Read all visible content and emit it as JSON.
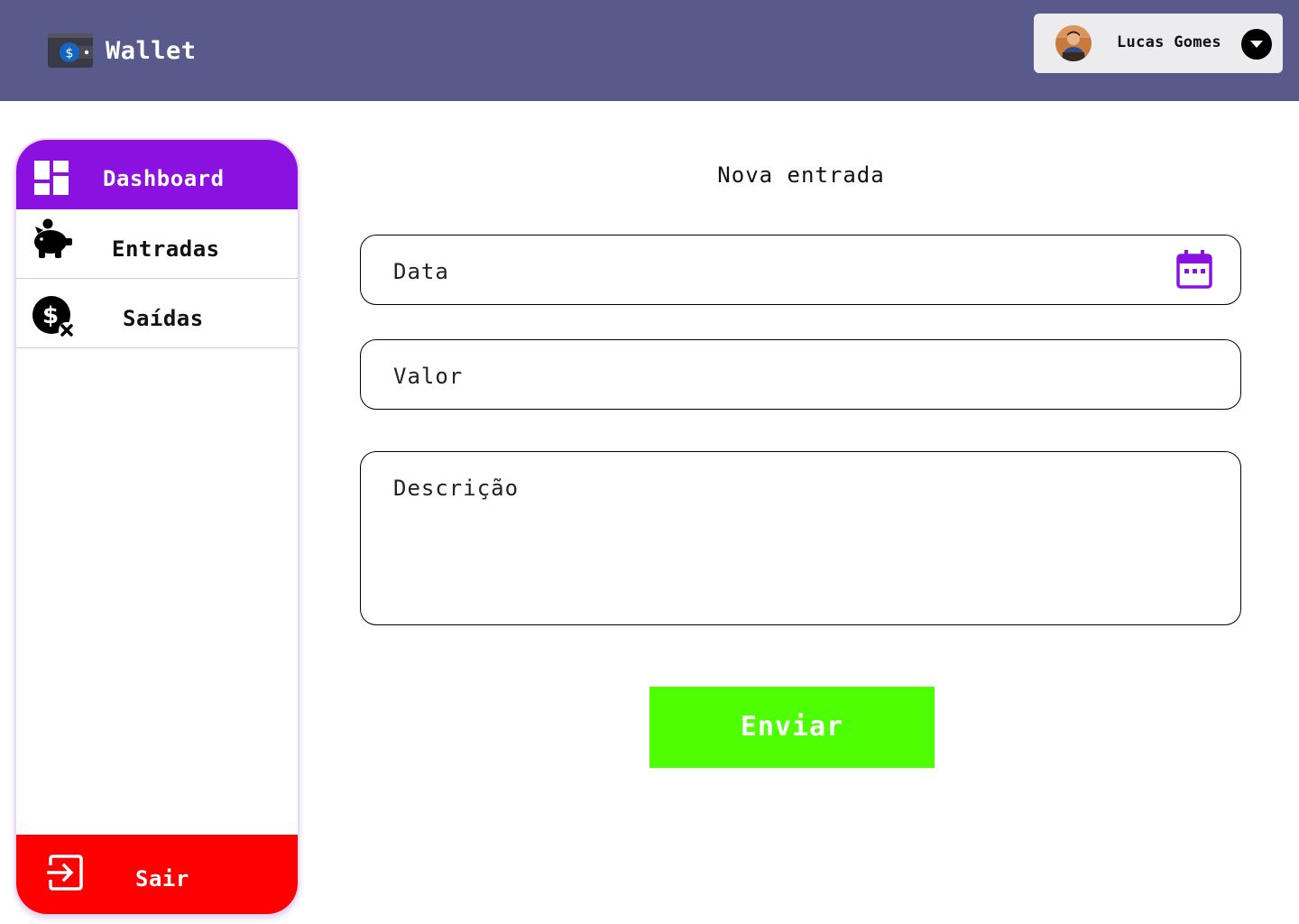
{
  "header": {
    "app_name": "Wallet",
    "logo_icon": "wallet-dollar-icon",
    "user": {
      "name": "Lucas Gomes",
      "avatar_icon": "user-avatar",
      "menu_icon": "caret-down-icon"
    },
    "background_color": "#585a8c"
  },
  "sidebar": {
    "items": [
      {
        "label": "Dashboard",
        "icon": "dashboard-icon",
        "active": true
      },
      {
        "label": "Entradas",
        "icon": "piggy-bank-icon"
      },
      {
        "label": "Saídas",
        "icon": "money-off-icon"
      }
    ],
    "logout": {
      "label": "Sair",
      "icon": "exit-icon"
    },
    "active_color": "#8a11e0",
    "logout_color": "#ff0000"
  },
  "form": {
    "title": "Nova entrada",
    "fields": {
      "data": {
        "placeholder": "Data",
        "icon": "calendar-icon"
      },
      "valor": {
        "placeholder": "Valor"
      },
      "descricao": {
        "placeholder": "Descrição"
      }
    },
    "submit_label": "Enviar",
    "submit_color": "#4dff00"
  }
}
